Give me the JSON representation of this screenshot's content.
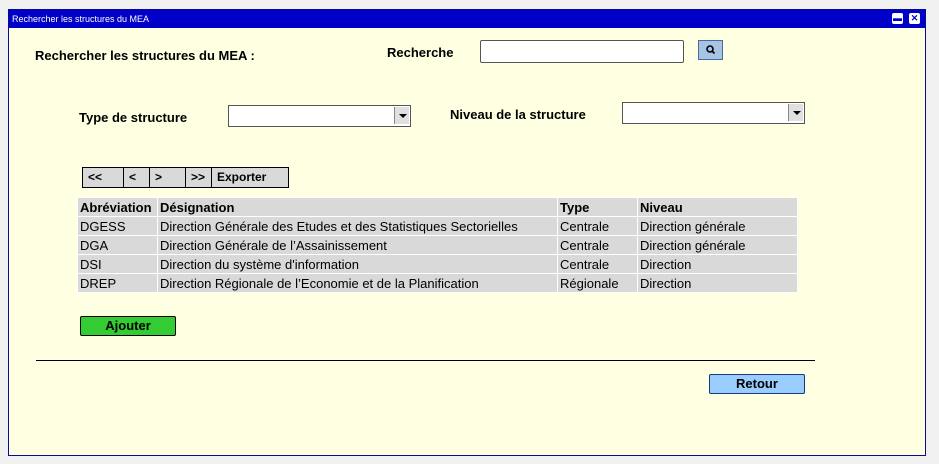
{
  "window": {
    "title": "Rechercher les structures du MEA"
  },
  "header": {
    "heading": "Rechercher les structures du MEA :",
    "search_label": "Recherche",
    "search_value": ""
  },
  "filters": {
    "type_label": "Type de structure",
    "type_value": "",
    "niveau_label": "Niveau de la structure",
    "niveau_value": ""
  },
  "pager": {
    "first": "<<",
    "prev": "<",
    "next": ">",
    "last": ">>",
    "export": "Exporter"
  },
  "table": {
    "headers": [
      "Abréviation",
      "Désignation",
      "Type",
      "Niveau"
    ],
    "rows": [
      [
        "DGESS",
        "Direction Générale des Etudes et des Statistiques Sectorielles",
        "Centrale",
        "Direction générale"
      ],
      [
        "DGA",
        "Direction Générale de l’Assainissement",
        "Centrale",
        "Direction générale"
      ],
      [
        "DSI",
        "Direction du système d'information",
        "Centrale",
        "Direction"
      ],
      [
        "DREP",
        "Direction Régionale de l’Economie et de la Planification",
        "Régionale",
        "Direction"
      ]
    ]
  },
  "actions": {
    "add_label": "Ajouter",
    "back_label": "Retour"
  },
  "colors": {
    "title_bar": "#0000c8",
    "background": "#ffffe1",
    "add_button": "#33cc33",
    "back_button": "#99ccff",
    "search_button": "#a8c4e4"
  },
  "icons": {
    "search": "magnifier-icon",
    "minimize": "minimize-icon",
    "close": "close-icon"
  }
}
